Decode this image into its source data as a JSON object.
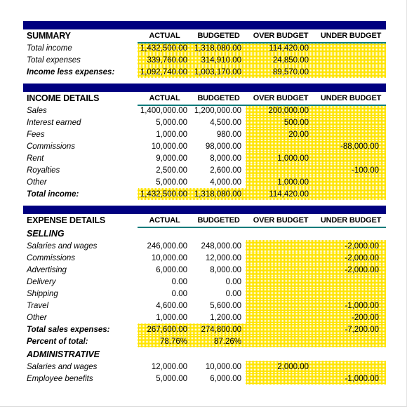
{
  "columns": {
    "actual": "ACTUAL",
    "budgeted": "BUDGETED",
    "over_budget": "OVER BUDGET",
    "under_budget": "UNDER BUDGET"
  },
  "colors": {
    "header_bar": "#000080",
    "underline": "#007B7B",
    "highlight": "#FFE400",
    "text": "#000000"
  },
  "summary": {
    "title": "SUMMARY",
    "rows": [
      {
        "label": "Total income",
        "actual": "1,432,500.00",
        "budgeted": "1,318,080.00",
        "over": "114,420.00",
        "under": ""
      },
      {
        "label": "Total expenses",
        "actual": "339,760.00",
        "budgeted": "314,910.00",
        "over": "24,850.00",
        "under": ""
      },
      {
        "label": "Income less expenses:",
        "actual": "1,092,740.00",
        "budgeted": "1,003,170.00",
        "over": "89,570.00",
        "under": ""
      }
    ]
  },
  "income_details": {
    "title": "INCOME DETAILS",
    "rows": [
      {
        "label": "Sales",
        "actual": "1,400,000.00",
        "budgeted": "1,200,000.00",
        "over": "200,000.00",
        "under": ""
      },
      {
        "label": "Interest earned",
        "actual": "5,000.00",
        "budgeted": "4,500.00",
        "over": "500.00",
        "under": ""
      },
      {
        "label": "Fees",
        "actual": "1,000.00",
        "budgeted": "980.00",
        "over": "20.00",
        "under": ""
      },
      {
        "label": "Commissions",
        "actual": "10,000.00",
        "budgeted": "98,000.00",
        "over": "",
        "under": "-88,000.00"
      },
      {
        "label": "Rent",
        "actual": "9,000.00",
        "budgeted": "8,000.00",
        "over": "1,000.00",
        "under": ""
      },
      {
        "label": "Royalties",
        "actual": "2,500.00",
        "budgeted": "2,600.00",
        "over": "",
        "under": "-100.00"
      },
      {
        "label": "Other",
        "actual": "5,000.00",
        "budgeted": "4,000.00",
        "over": "1,000.00",
        "under": ""
      }
    ],
    "total": {
      "label": "Total income:",
      "actual": "1,432,500.00",
      "budgeted": "1,318,080.00",
      "over": "114,420.00",
      "under": ""
    }
  },
  "expense_details": {
    "title": "EXPENSE DETAILS",
    "selling": {
      "heading": "SELLING",
      "rows": [
        {
          "label": "Salaries and wages",
          "actual": "246,000.00",
          "budgeted": "248,000.00",
          "over": "",
          "under": "-2,000.00"
        },
        {
          "label": "Commissions",
          "actual": "10,000.00",
          "budgeted": "12,000.00",
          "over": "",
          "under": "-2,000.00"
        },
        {
          "label": "Advertising",
          "actual": "6,000.00",
          "budgeted": "8,000.00",
          "over": "",
          "under": "-2,000.00"
        },
        {
          "label": "Delivery",
          "actual": "0.00",
          "budgeted": "0.00",
          "over": "",
          "under": ""
        },
        {
          "label": "Shipping",
          "actual": "0.00",
          "budgeted": "0.00",
          "over": "",
          "under": ""
        },
        {
          "label": "Travel",
          "actual": "4,600.00",
          "budgeted": "5,600.00",
          "over": "",
          "under": "-1,000.00"
        },
        {
          "label": "Other",
          "actual": "1,000.00",
          "budgeted": "1,200.00",
          "over": "",
          "under": "-200.00"
        }
      ],
      "total": {
        "label": "Total sales expenses:",
        "actual": "267,600.00",
        "budgeted": "274,800.00",
        "over": "",
        "under": "-7,200.00"
      },
      "percent": {
        "label": "Percent of total:",
        "actual": "78.76%",
        "budgeted": "87.26%",
        "over": "",
        "under": ""
      }
    },
    "administrative": {
      "heading": "ADMINISTRATIVE",
      "rows": [
        {
          "label": "Salaries and wages",
          "actual": "12,000.00",
          "budgeted": "10,000.00",
          "over": "2,000.00",
          "under": ""
        },
        {
          "label": "Employee benefits",
          "actual": "5,000.00",
          "budgeted": "6,000.00",
          "over": "",
          "under": "-1,000.00"
        }
      ]
    }
  }
}
